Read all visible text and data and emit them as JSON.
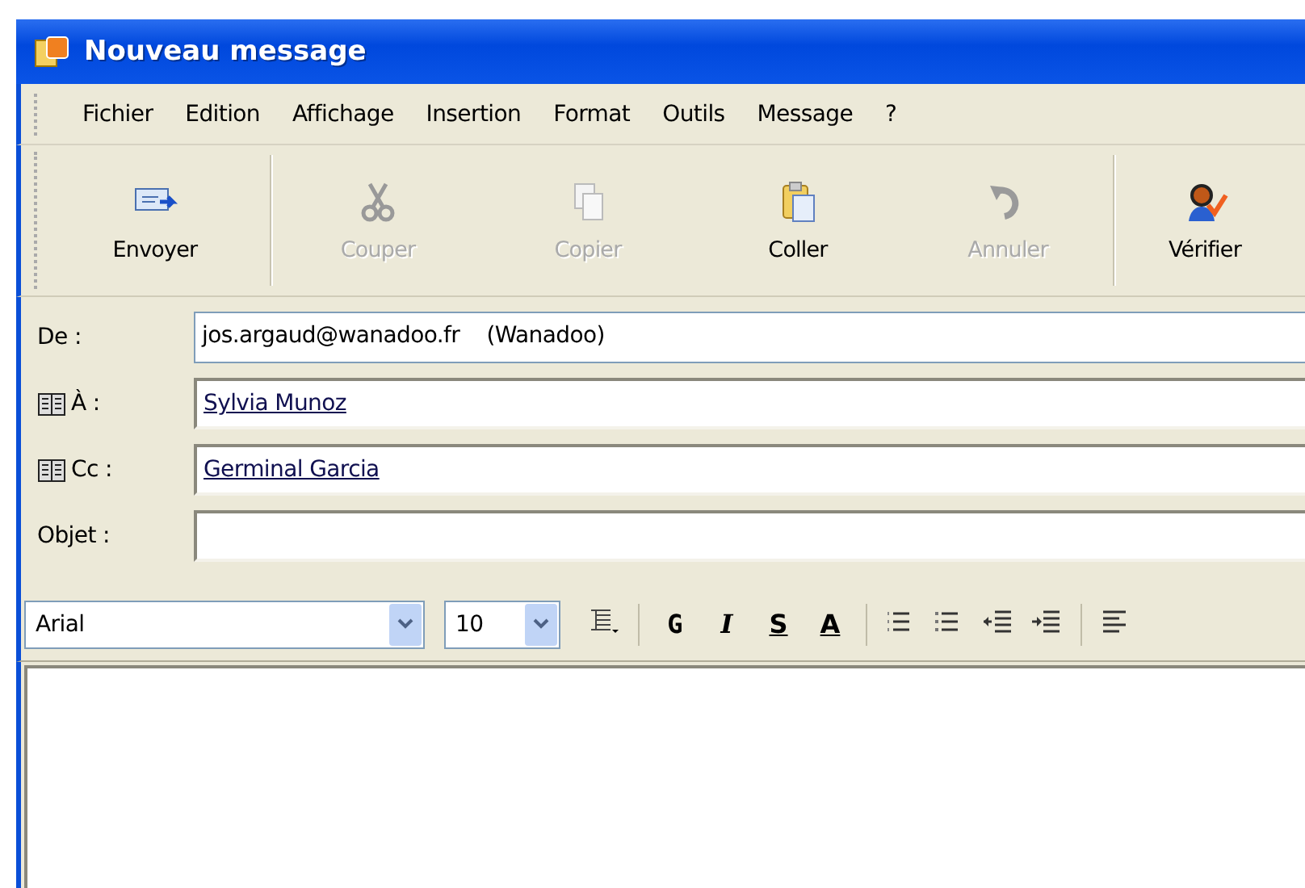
{
  "window": {
    "title": "Nouveau message"
  },
  "menu": [
    "Fichier",
    "Edition",
    "Affichage",
    "Insertion",
    "Format",
    "Outils",
    "Message",
    "?"
  ],
  "toolbar": [
    {
      "kind": "send",
      "label": "Envoyer",
      "disabled": false
    },
    {
      "kind": "cut",
      "label": "Couper",
      "disabled": true
    },
    {
      "kind": "copy",
      "label": "Copier",
      "disabled": true
    },
    {
      "kind": "paste",
      "label": "Coller",
      "disabled": false
    },
    {
      "kind": "undo",
      "label": "Annuler",
      "disabled": true
    },
    {
      "kind": "check",
      "label": "Vérifier",
      "disabled": false
    }
  ],
  "header": [
    {
      "kind": "plain",
      "label": "De :",
      "value": "jos.argaud@wanadoo.fr    (Wanadoo)"
    },
    {
      "kind": "address",
      "label": "À :",
      "value": "Sylvia Munoz"
    },
    {
      "kind": "address",
      "label": "Cc :",
      "value": "Germinal Garcia"
    },
    {
      "kind": "plain",
      "label": "Objet :"
    }
  ],
  "format_bar": {
    "font": "Arial",
    "size": "10",
    "tools": [
      {
        "kind": "style"
      },
      {
        "kind": "bold",
        "text": "G"
      },
      {
        "kind": "italic",
        "text": "I"
      },
      {
        "kind": "underline",
        "text": "S"
      },
      {
        "kind": "color",
        "text": "A"
      },
      {
        "kind": "numbered"
      },
      {
        "kind": "bullets"
      },
      {
        "kind": "outdent"
      },
      {
        "kind": "indent"
      },
      {
        "kind": "align"
      }
    ]
  }
}
